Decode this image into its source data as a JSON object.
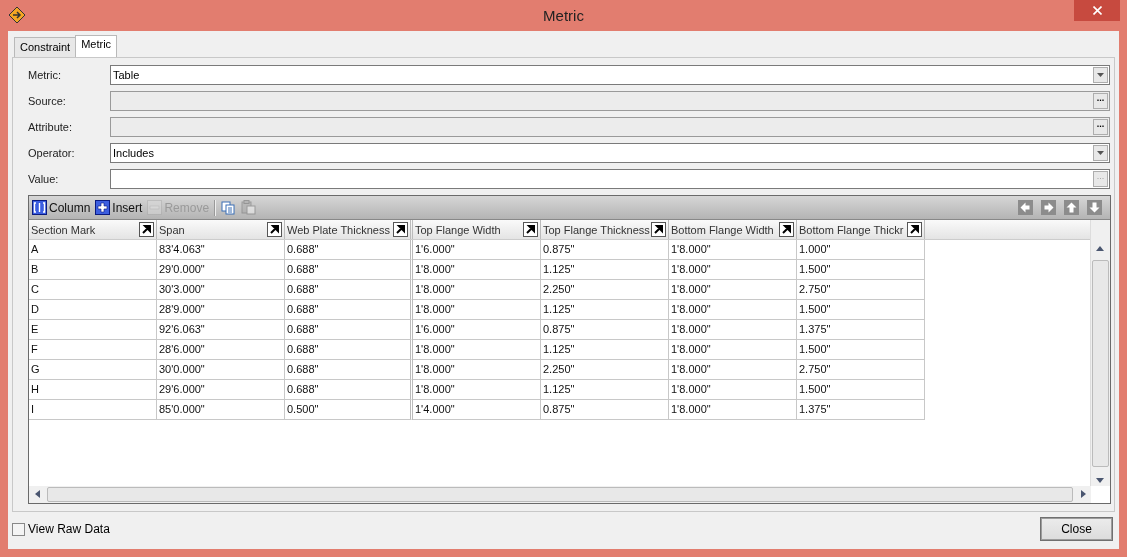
{
  "window": {
    "title": "Metric"
  },
  "tabs": [
    {
      "label": "Constraint",
      "selected": false
    },
    {
      "label": "Metric",
      "selected": true
    }
  ],
  "fields": [
    {
      "label": "Metric:",
      "kind": "dropdown",
      "value": "Table",
      "disabled": false
    },
    {
      "label": "Source:",
      "kind": "browse",
      "disabled": true,
      "button_text": "...",
      "button_disabled": false
    },
    {
      "label": "Attribute:",
      "kind": "browse",
      "disabled": true,
      "button_text": "...",
      "button_disabled": false
    },
    {
      "label": "Operator:",
      "kind": "dropdown",
      "value": "Includes",
      "disabled": false
    },
    {
      "label": "Value:",
      "kind": "browse",
      "disabled": false,
      "button_text": "...",
      "button_disabled": true
    }
  ],
  "toolbar": [
    {
      "kind": "column",
      "label": "Column",
      "disabled": false
    },
    {
      "kind": "insert",
      "label": "Insert",
      "disabled": false
    },
    {
      "kind": "remove",
      "label": "Remove",
      "disabled": true
    },
    {
      "kind": "copy",
      "disabled": false
    },
    {
      "kind": "paste",
      "disabled": true
    }
  ],
  "nav_buttons": [
    {
      "kind": "left"
    },
    {
      "kind": "right"
    },
    {
      "kind": "up"
    },
    {
      "kind": "down"
    }
  ],
  "table": {
    "columns": [
      "Section Mark",
      "Span",
      "Web Plate Thickness",
      "Top Flange Width",
      "Top Flange Thickness",
      "Bottom Flange Width",
      "Bottom Flange Thickr"
    ],
    "rows": [
      [
        "A",
        "83'4.063\"",
        "0.688\"",
        "1'6.000\"",
        "0.875\"",
        "1'8.000\"",
        "1.000\""
      ],
      [
        "B",
        "29'0.000\"",
        "0.688\"",
        "1'8.000\"",
        "1.125\"",
        "1'8.000\"",
        "1.500\""
      ],
      [
        "C",
        "30'3.000\"",
        "0.688\"",
        "1'8.000\"",
        "2.250\"",
        "1'8.000\"",
        "2.750\""
      ],
      [
        "D",
        "28'9.000\"",
        "0.688\"",
        "1'8.000\"",
        "1.125\"",
        "1'8.000\"",
        "1.500\""
      ],
      [
        "E",
        "92'6.063\"",
        "0.688\"",
        "1'6.000\"",
        "0.875\"",
        "1'8.000\"",
        "1.375\""
      ],
      [
        "F",
        "28'6.000\"",
        "0.688\"",
        "1'8.000\"",
        "1.125\"",
        "1'8.000\"",
        "1.500\""
      ],
      [
        "G",
        "30'0.000\"",
        "0.688\"",
        "1'8.000\"",
        "2.250\"",
        "1'8.000\"",
        "2.750\""
      ],
      [
        "H",
        "29'6.000\"",
        "0.688\"",
        "1'8.000\"",
        "1.125\"",
        "1'8.000\"",
        "1.500\""
      ],
      [
        "I",
        "85'0.000\"",
        "0.500\"",
        "1'4.000\"",
        "0.875\"",
        "1'8.000\"",
        "1.375\""
      ]
    ]
  },
  "view_raw_data": {
    "label": "View Raw Data",
    "checked": false
  },
  "close_button": "Close"
}
